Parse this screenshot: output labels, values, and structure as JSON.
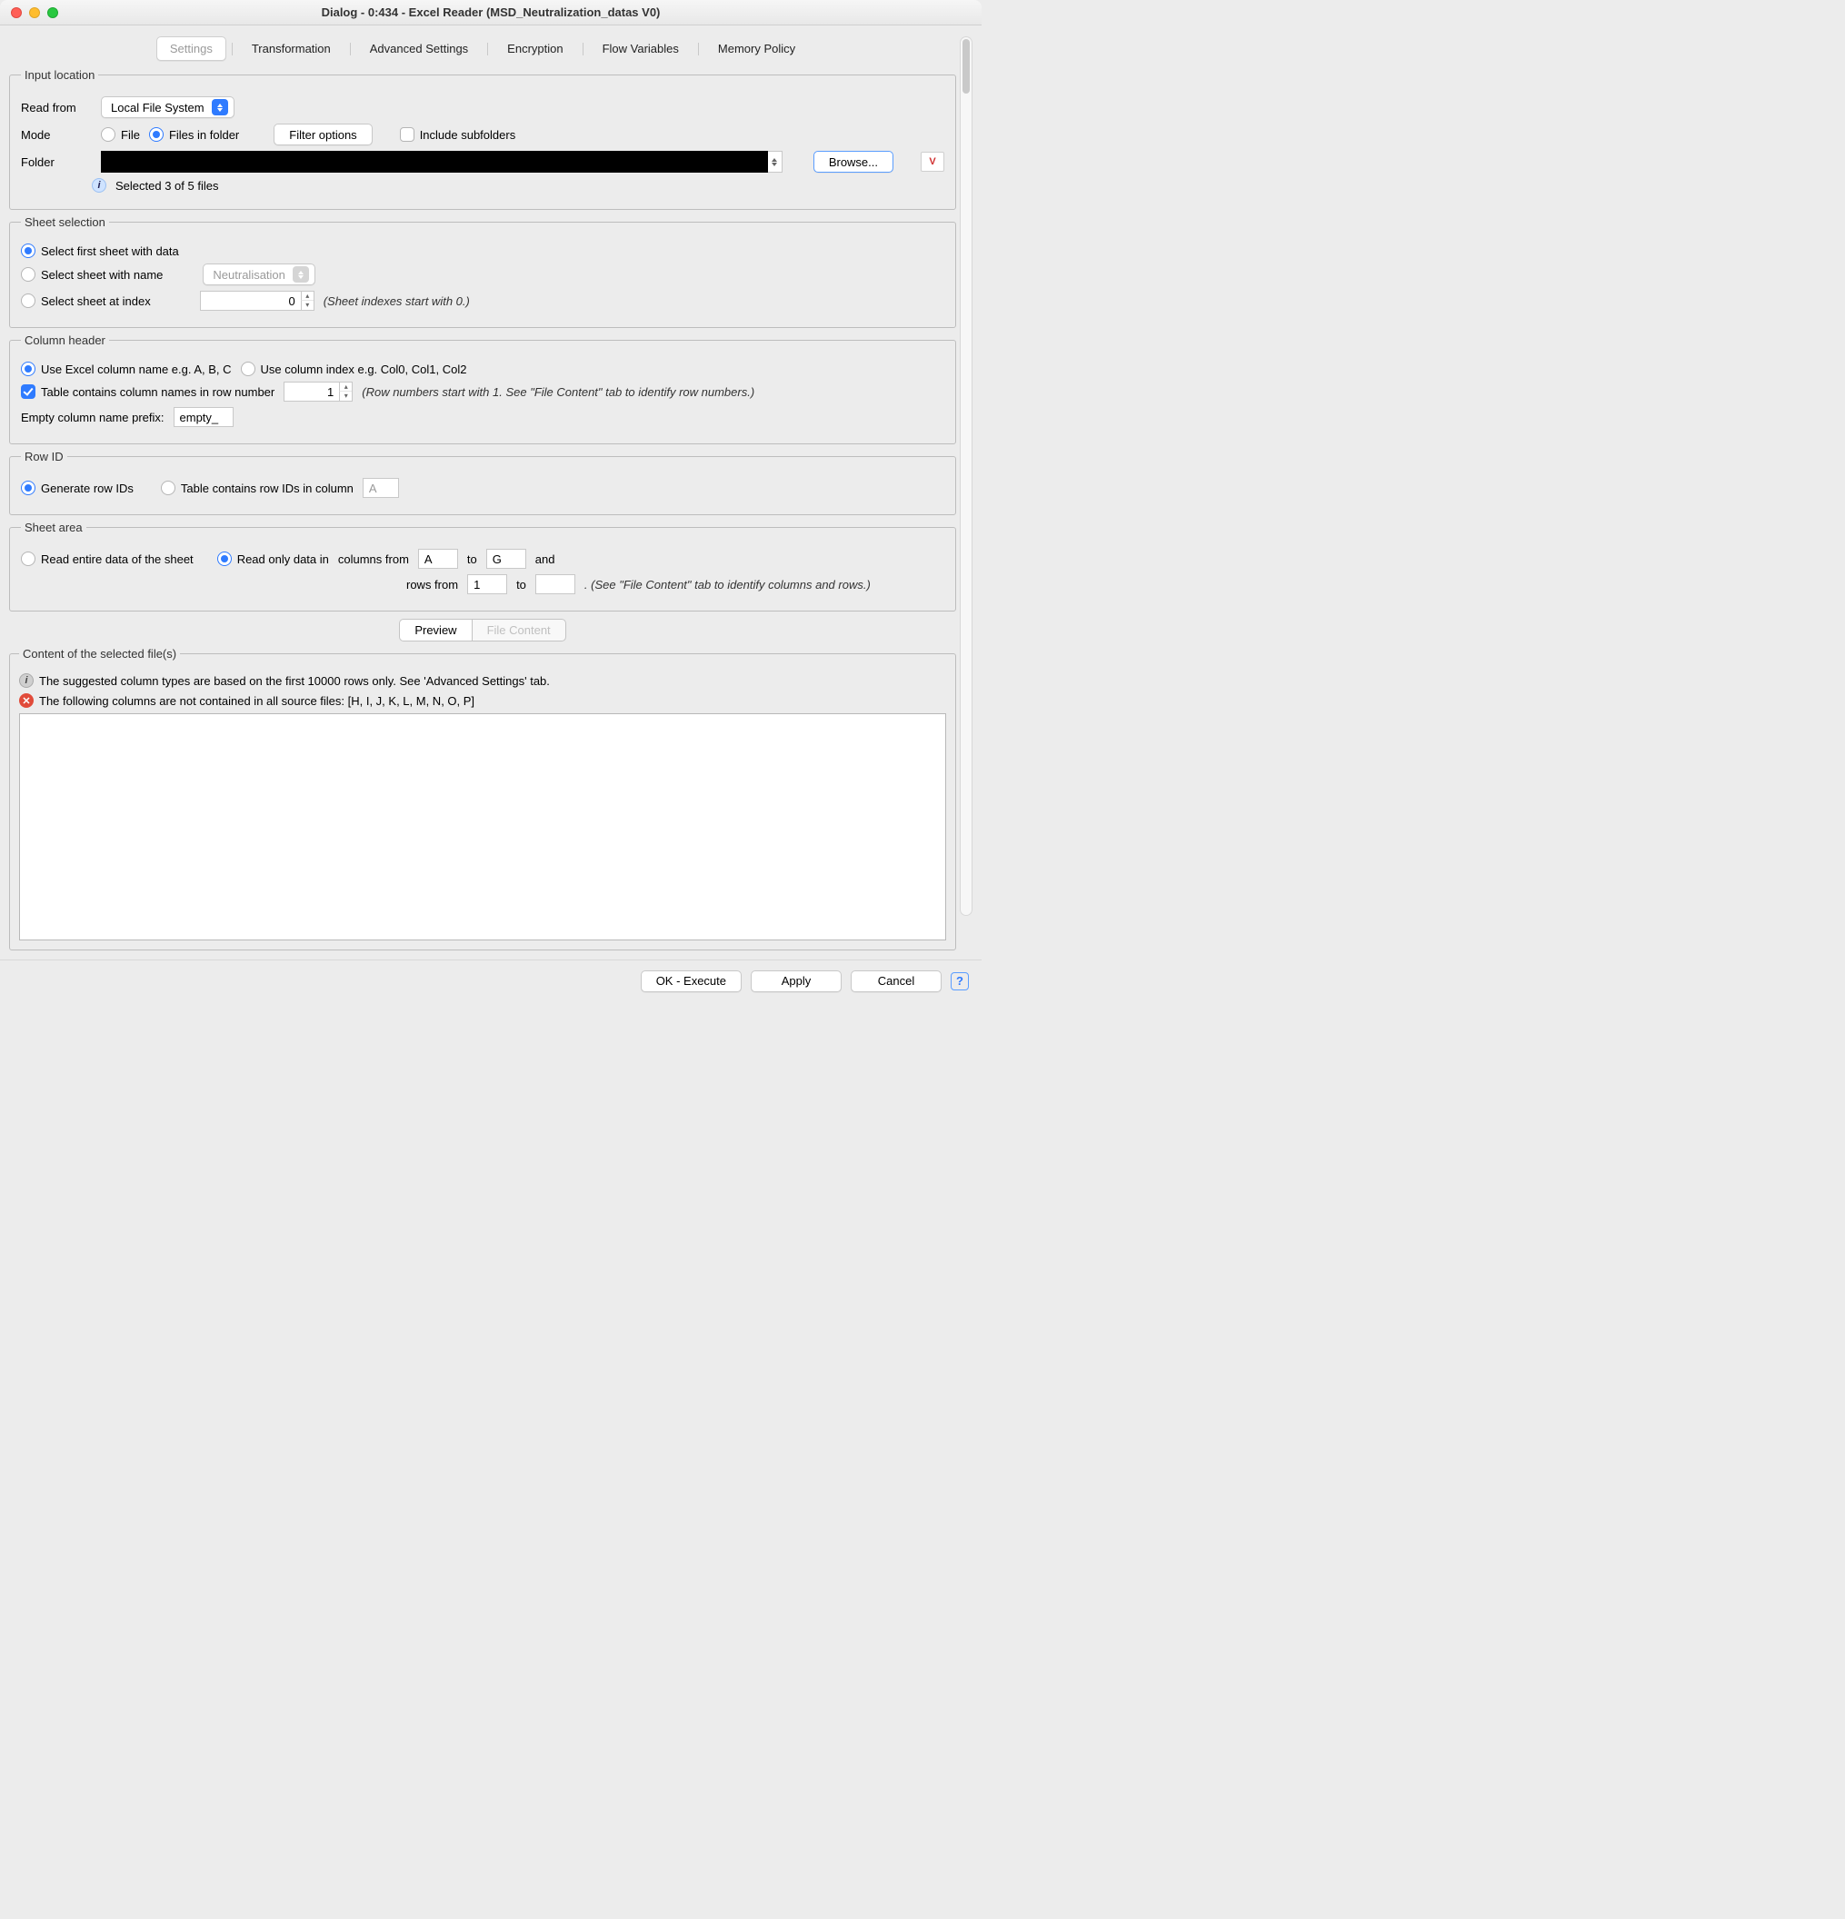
{
  "window": {
    "title": "Dialog - 0:434 - Excel Reader (MSD_Neutralization_datas V0)"
  },
  "tabs": {
    "settings": "Settings",
    "transformation": "Transformation",
    "advanced": "Advanced Settings",
    "encryption": "Encryption",
    "flow": "Flow Variables",
    "memory": "Memory Policy"
  },
  "input_location": {
    "legend": "Input location",
    "read_from_label": "Read from",
    "read_from_value": "Local File System",
    "mode_label": "Mode",
    "mode_file": "File",
    "mode_folder": "Files in folder",
    "filter_options": "Filter options",
    "include_subfolders": "Include subfolders",
    "folder_label": "Folder",
    "browse": "Browse...",
    "status": "Selected 3 of 5 files"
  },
  "sheet_selection": {
    "legend": "Sheet selection",
    "first_sheet": "Select first sheet with data",
    "by_name": "Select sheet with name",
    "name_value": "Neutralisation",
    "by_index": "Select sheet at index",
    "index_value": "0",
    "index_note": "(Sheet indexes start with 0.)"
  },
  "column_header": {
    "legend": "Column header",
    "use_excel": "Use Excel column name e.g. A, B, C",
    "use_index": "Use column index e.g. Col0, Col1, Col2",
    "table_contains": "Table contains column names in row number",
    "row_number": "1",
    "row_note": "(Row numbers start with 1. See \"File Content\" tab to identify row numbers.)",
    "empty_prefix_label": "Empty column name prefix:",
    "empty_prefix_value": "empty_"
  },
  "row_id": {
    "legend": "Row ID",
    "generate": "Generate row IDs",
    "from_column": "Table contains row IDs in column",
    "column_value": "A"
  },
  "sheet_area": {
    "legend": "Sheet area",
    "entire": "Read entire data of the sheet",
    "partial": "Read only data in",
    "cols_from_label": "columns from",
    "cols_from": "A",
    "to_label": "to",
    "cols_to": "G",
    "and_label": "and",
    "rows_from_label": "rows from",
    "rows_from": "1",
    "rows_to": "",
    "rows_note": ". (See \"File Content\" tab to identify columns and rows.)"
  },
  "preview": {
    "tab_preview": "Preview",
    "tab_content": "File Content",
    "legend": "Content of the selected file(s)",
    "info": "The suggested column types are based on the first 10000 rows only. See 'Advanced Settings' tab.",
    "error": "The following columns are not contained in all source files: [H, I, J, K, L, M, N, O, P]"
  },
  "footer": {
    "ok": "OK - Execute",
    "apply": "Apply",
    "cancel": "Cancel"
  }
}
